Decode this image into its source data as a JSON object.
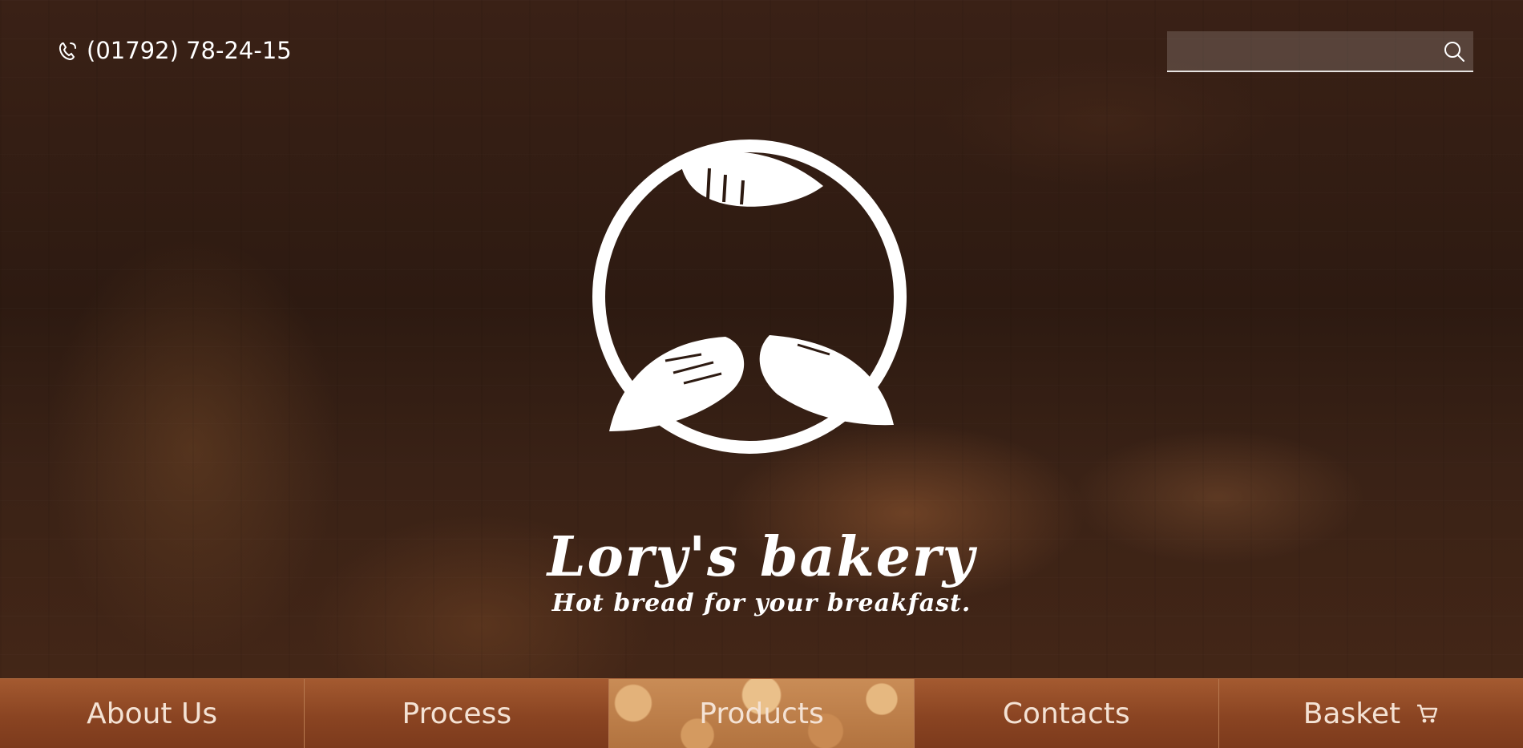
{
  "header": {
    "phone": "(01792) 78-24-15",
    "search": {
      "placeholder": "",
      "value": ""
    }
  },
  "brand": {
    "title": "Lory's bakery",
    "tagline": "Hot bread for your breakfast."
  },
  "nav": {
    "items": [
      {
        "label": "About Us"
      },
      {
        "label": "Process"
      },
      {
        "label": "Products"
      },
      {
        "label": "Contacts"
      },
      {
        "label": "Basket"
      }
    ],
    "active_index": 2
  },
  "colors": {
    "nav_background": "#8a4422",
    "overlay": "#2d1a11",
    "text": "#ffffff"
  },
  "icons": {
    "phone": "phone-icon",
    "search": "search-icon",
    "basket": "cart-icon",
    "logo": "bread-leaves-logo"
  }
}
